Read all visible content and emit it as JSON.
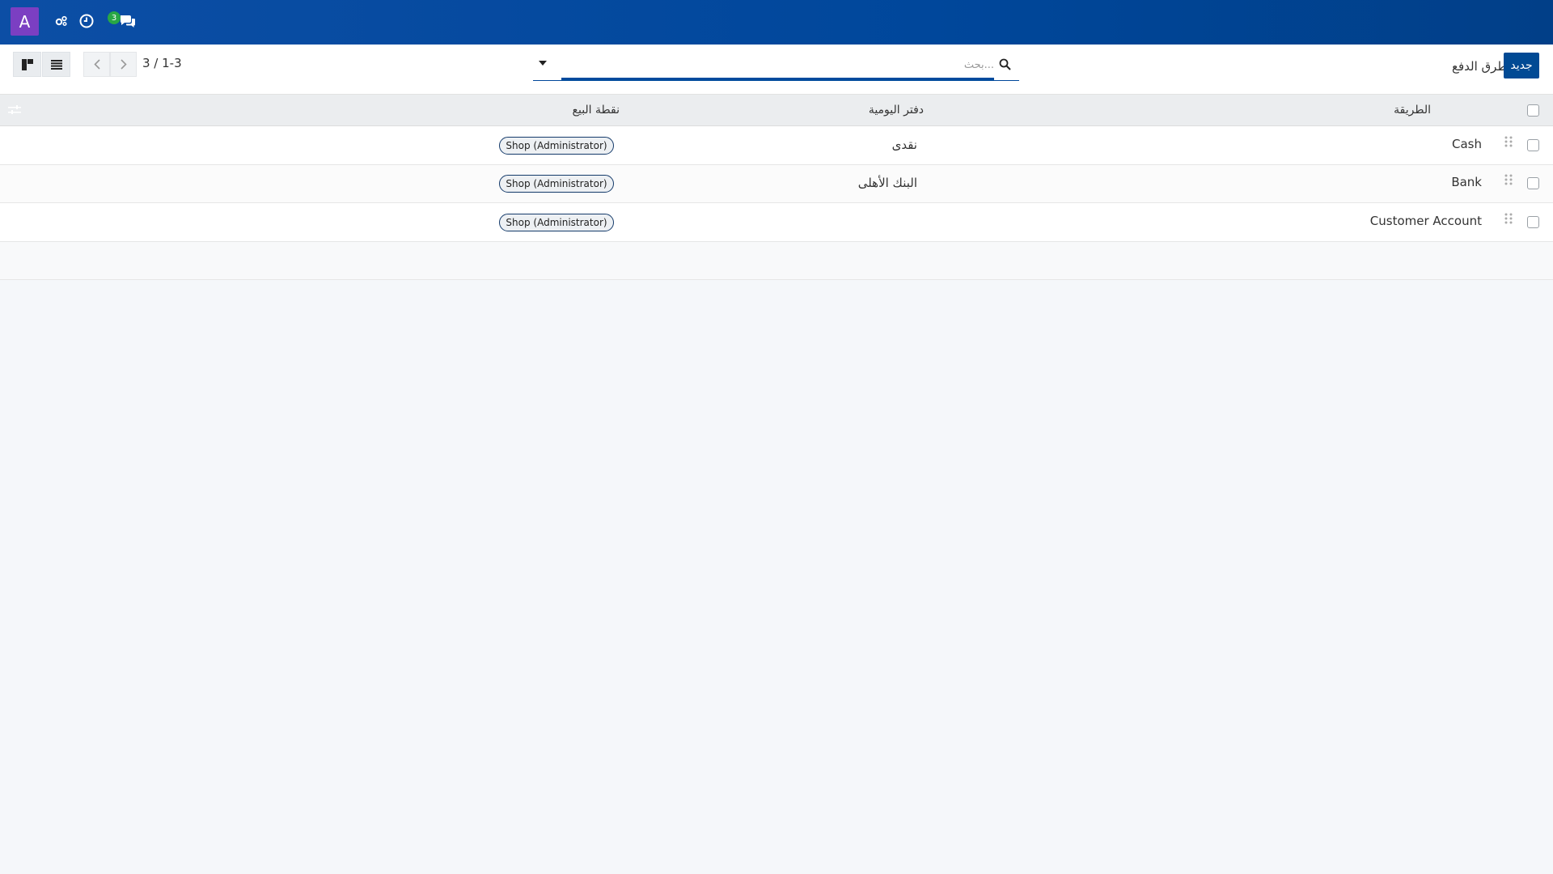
{
  "navbar": {
    "avatar_letter": "A",
    "icons": [
      "debug-icon",
      "clock-icon",
      "chat-icon"
    ],
    "message_count": "3"
  },
  "control": {
    "pager": "3 / 1-3",
    "search_placeholder": "بحث...",
    "breadcrumb": "طرق الدفع",
    "new_label": "جديد"
  },
  "table": {
    "headers": {
      "method": "الطريقة",
      "journal": "دفتر اليومية",
      "pos": "نقطة البيع"
    },
    "rows": [
      {
        "method": "Cash",
        "journal": "نقدى",
        "pos": "Shop (Administrator)"
      },
      {
        "method": "Bank",
        "journal": "البنك الأهلى",
        "pos": "Shop (Administrator)"
      },
      {
        "method": "Customer Account",
        "journal": "",
        "pos": "Shop (Administrator)"
      }
    ]
  },
  "colors": {
    "navbar": "#00479b",
    "primary_button": "#014a94",
    "avatar": "#7b3fc2",
    "badge": "#28a745"
  }
}
